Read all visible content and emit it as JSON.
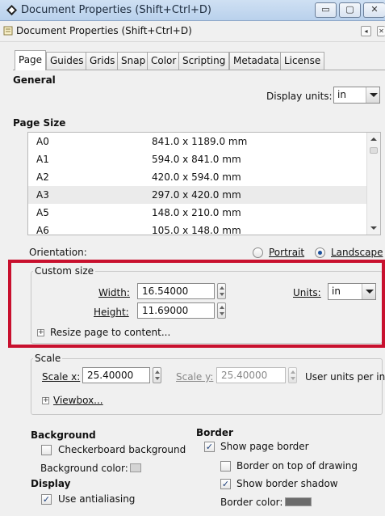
{
  "window": {
    "title": "Document Properties (Shift+Ctrl+D)",
    "btn_minimize": "▭",
    "btn_maximize": "▢",
    "btn_close": "✕"
  },
  "dialog": {
    "title": "Document Properties (Shift+Ctrl+D)",
    "btn_dock": "◂",
    "btn_close": "✕"
  },
  "tabs": [
    "Page",
    "Guides",
    "Grids",
    "Snap",
    "Color",
    "Scripting",
    "Metadata",
    "License"
  ],
  "general": {
    "heading": "General",
    "display_units_label": "Display units:",
    "display_units_value": "in"
  },
  "page_size": {
    "heading": "Page Size",
    "rows": [
      {
        "name": "A0",
        "size": "841.0 x 1189.0 mm"
      },
      {
        "name": "A1",
        "size": "594.0 x 841.0 mm"
      },
      {
        "name": "A2",
        "size": "420.0 x 594.0 mm"
      },
      {
        "name": "A3",
        "size": "297.0 x 420.0 mm"
      },
      {
        "name": "A5",
        "size": "148.0 x 210.0 mm"
      },
      {
        "name": "A6",
        "size": "105.0 x 148.0 mm"
      }
    ],
    "orientation_label": "Orientation:",
    "portrait": "Portrait",
    "landscape": "Landscape"
  },
  "custom_size": {
    "title": "Custom size",
    "width_label": "Width:",
    "width_value": "16.54000",
    "height_label": "Height:",
    "height_value": "11.69000",
    "units_label": "Units:",
    "units_value": "in",
    "resize_label": "Resize page to content..."
  },
  "scale": {
    "title": "Scale",
    "scale_x_label": "Scale x:",
    "scale_x_value": "25.40000",
    "scale_y_label": "Scale y:",
    "scale_y_value": "25.40000",
    "user_units": "User units per in.",
    "viewbox_label": "Viewbox..."
  },
  "background": {
    "heading": "Background",
    "checkerboard": "Checkerboard background",
    "color_label": "Background color:"
  },
  "display": {
    "heading": "Display",
    "antialiasing": "Use antialiasing"
  },
  "border": {
    "heading": "Border",
    "show_border": "Show page border",
    "border_on_top": "Border on top of drawing",
    "border_shadow": "Show border shadow",
    "color_label": "Border color:"
  },
  "colors": {
    "highlight": "#c8102e",
    "border_swatch": "#6b6b6b",
    "background_swatch": "#d4d4d4"
  }
}
